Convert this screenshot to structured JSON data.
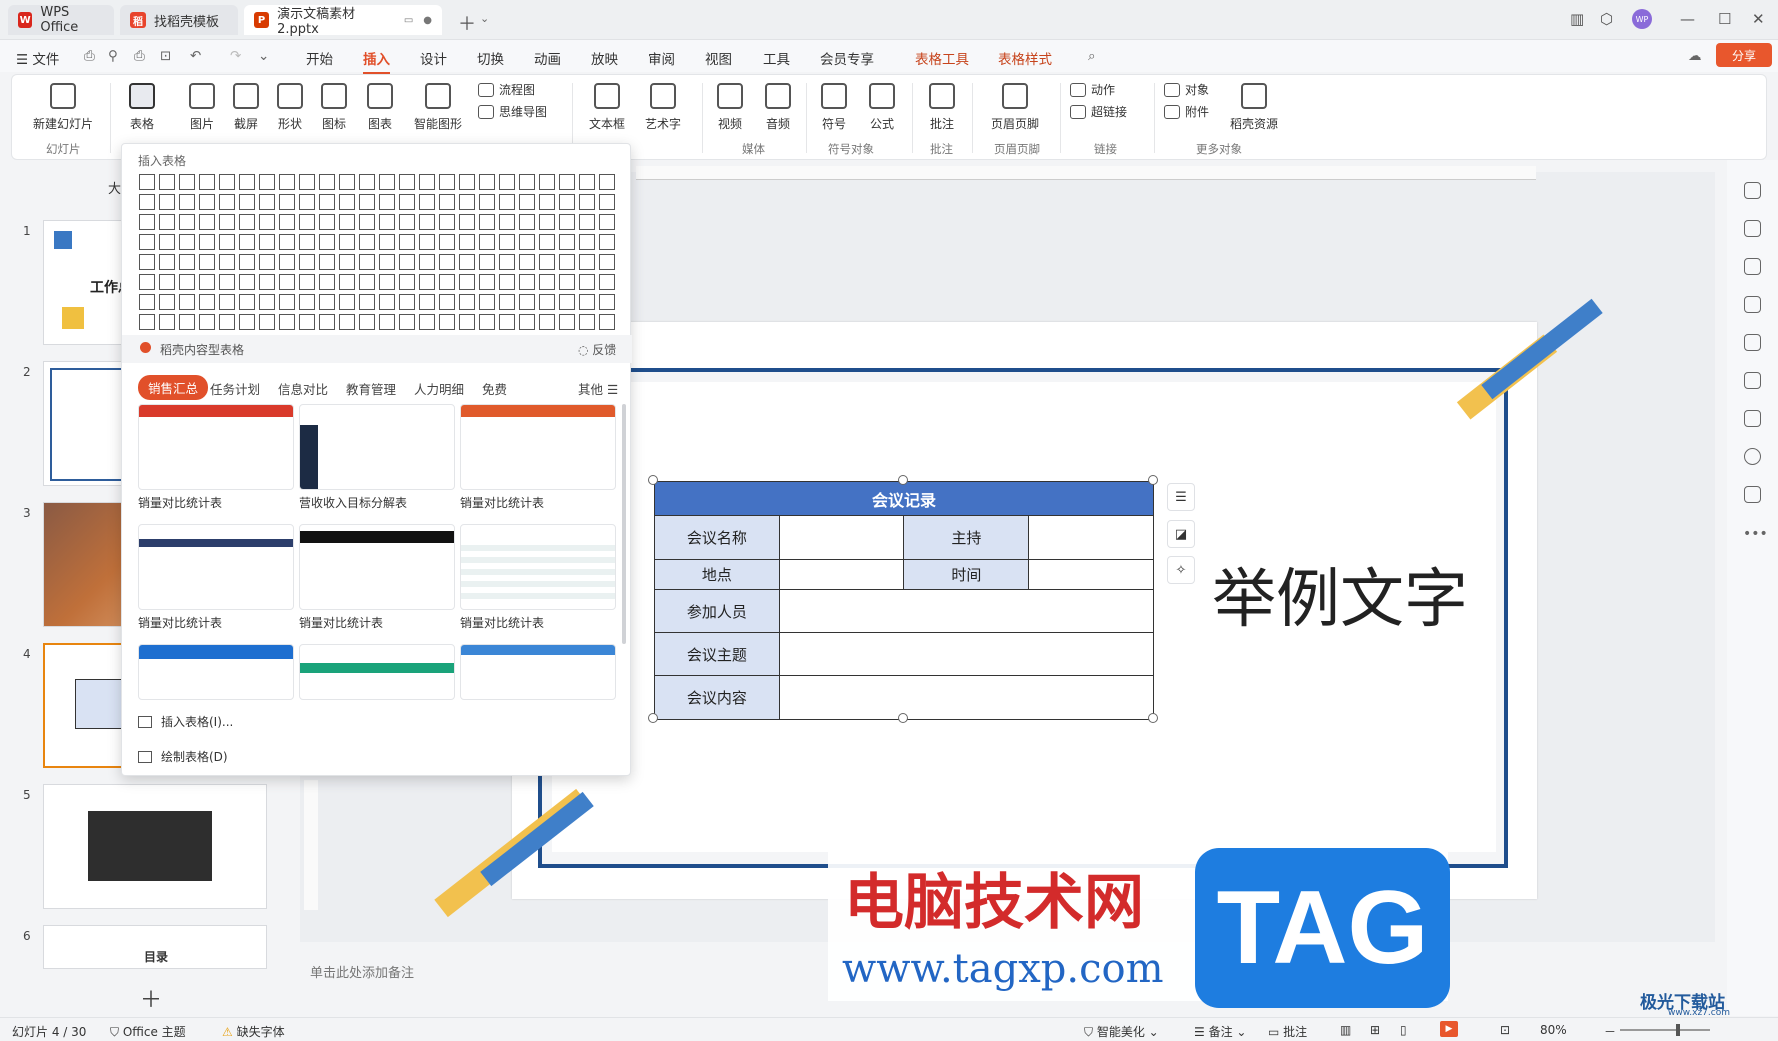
{
  "tabs": {
    "wps": "WPS Office",
    "find": "找稻壳模板",
    "doc": "演示文稿素材2.pptx"
  },
  "menu": {
    "file": "文件",
    "start": "开始",
    "insert": "插入",
    "design": "设计",
    "switch": "切换",
    "animation": "动画",
    "slideshow": "放映",
    "review": "审阅",
    "view": "视图",
    "tools": "工具",
    "member": "会员专享",
    "tabletools": "表格工具",
    "tablestyle": "表格样式",
    "share": "分享"
  },
  "ribbon": {
    "newslide": "新建幻灯片",
    "table": "表格",
    "picture": "图片",
    "screenshot": "截屏",
    "shape": "形状",
    "icon": "图标",
    "chart": "图表",
    "smartart": "智能图形",
    "flow": "流程图",
    "mind": "思维导图",
    "textbox": "文本框",
    "art": "艺术字",
    "video": "视频",
    "audio": "音频",
    "symbol": "符号",
    "formula": "公式",
    "comment": "批注",
    "header": "页眉页脚",
    "action": "动作",
    "link": "超链接",
    "object": "对象",
    "attach": "附件",
    "resource": "稻壳资源",
    "g_slide": "幻灯片",
    "g_media": "媒体",
    "g_symbol": "符号对象",
    "g_comment": "批注",
    "g_header": "页眉页脚",
    "g_link": "链接",
    "g_more": "更多对象"
  },
  "panel": {
    "insert_table": "插入表格",
    "docer": "稻壳内容型表格",
    "feedback": "反馈",
    "cats": [
      "销售汇总",
      "任务计划",
      "信息对比",
      "教育管理",
      "人力明细",
      "免费"
    ],
    "other": "其他",
    "thumbs": [
      "销量对比统计表",
      "营收收入目标分解表",
      "销量对比统计表",
      "销量对比统计表",
      "销量对比统计表",
      "销量对比统计表"
    ],
    "insert_link": "插入表格(I)...",
    "draw_link": "绘制表格(D)"
  },
  "slides": {
    "nums": [
      "1",
      "2",
      "3",
      "4",
      "5",
      "6"
    ],
    "s1_title": "工作总结",
    "s6_title": "目录"
  },
  "table": {
    "title": "会议记录",
    "name": "会议名称",
    "host": "主持",
    "place": "地点",
    "time": "时间",
    "people": "参加人员",
    "topic": "会议主题",
    "content": "会议内容"
  },
  "sample": "举例文字",
  "notes": "单击此处添加备注",
  "status": {
    "slide": "幻灯片 4 / 30",
    "theme": "Office 主题",
    "font": "缺失字体",
    "beauty": "智能美化",
    "notes": "备注",
    "comment": "批注",
    "zoom": "80%"
  },
  "watermark": {
    "cn": "电脑技术网",
    "url": "www.tagxp.com",
    "tag": "TAG",
    "logo": "极光下载站",
    "logo_url": "www.xz7.com"
  },
  "left_label": "大"
}
